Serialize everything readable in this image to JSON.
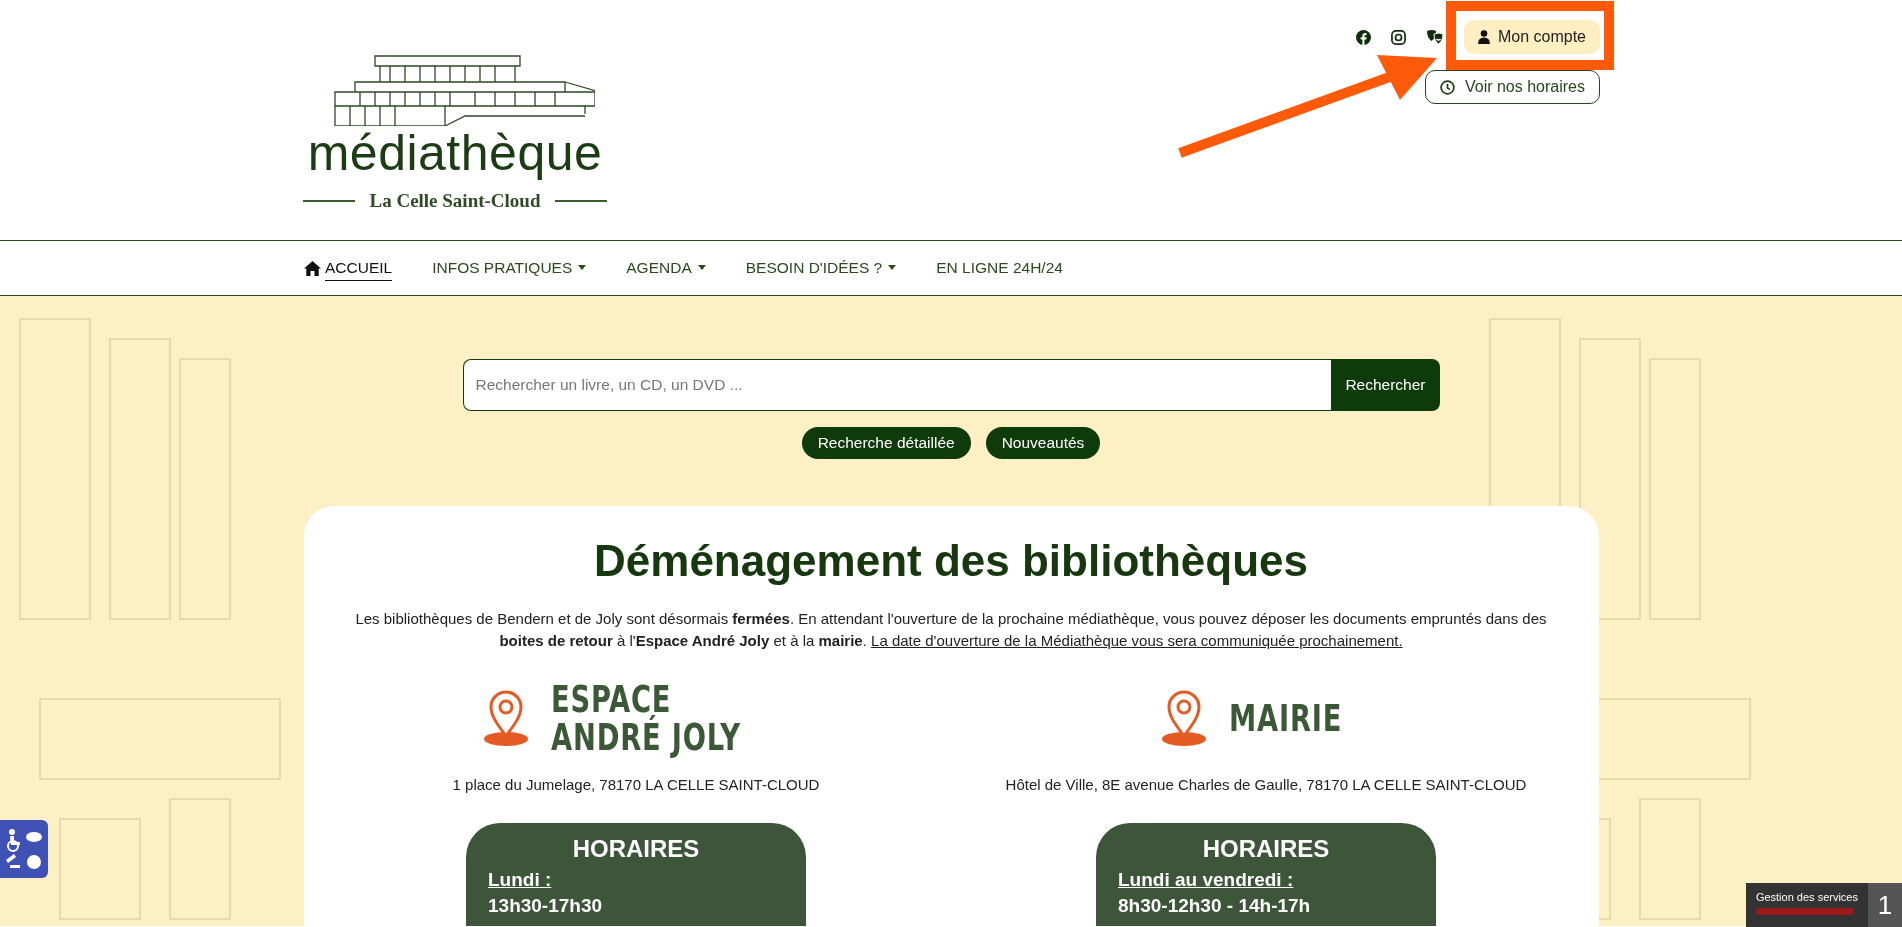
{
  "header": {
    "account_button": "Mon compte",
    "hours_button": "Voir nos horaires"
  },
  "logo": {
    "title": "médiathèque",
    "subtitle": "La Celle Saint-Cloud"
  },
  "nav": [
    {
      "label": "ACCUEIL",
      "selected": true,
      "dropdown": false
    },
    {
      "label": "INFOS PRATIQUES",
      "selected": false,
      "dropdown": true
    },
    {
      "label": "AGENDA",
      "selected": false,
      "dropdown": true
    },
    {
      "label": "BESOIN D'IDÉES ?",
      "selected": false,
      "dropdown": true
    },
    {
      "label": "EN LIGNE 24H/24",
      "selected": false,
      "dropdown": false
    }
  ],
  "search": {
    "placeholder": "Rechercher un livre, un CD, un DVD ...",
    "button": "Rechercher"
  },
  "quick_links": [
    "Recherche détaillée",
    "Nouveautés"
  ],
  "announcement": {
    "title": "Déménagement des bibliothèques",
    "text": "Les bibliothèques de Bendern et de Joly sont désormais **fermées**. En attendant l'ouverture de la prochaine médiathèque, vous pouvez déposer les documents empruntés dans des **boites de retour** à l'**Espace André Joly** et à la **mairie**.",
    "link": "La date d'ouverture de la Médiathèque vous sera communiquée prochainement."
  },
  "locations": [
    {
      "name_lines": [
        "ESPACE",
        "ANDRÉ JOLY"
      ],
      "address": "1 place du Jumelage, 78170 LA CELLE SAINT-CLOUD",
      "hours_title": "HORAIRES",
      "schedule": [
        {
          "day": "Lundi :",
          "hours": "13h30-17h30"
        }
      ]
    },
    {
      "name_lines": [
        "MAIRIE"
      ],
      "address": "Hôtel de Ville, 8E avenue Charles de Gaulle, 78170 LA CELLE SAINT-CLOUD",
      "hours_title": "HORAIRES",
      "schedule": [
        {
          "day": "Lundi au vendredi :",
          "hours": "8h30-12h30 - 14h-17h"
        }
      ]
    }
  ],
  "services_widget": {
    "label": "Gestion des services",
    "count": "1"
  }
}
